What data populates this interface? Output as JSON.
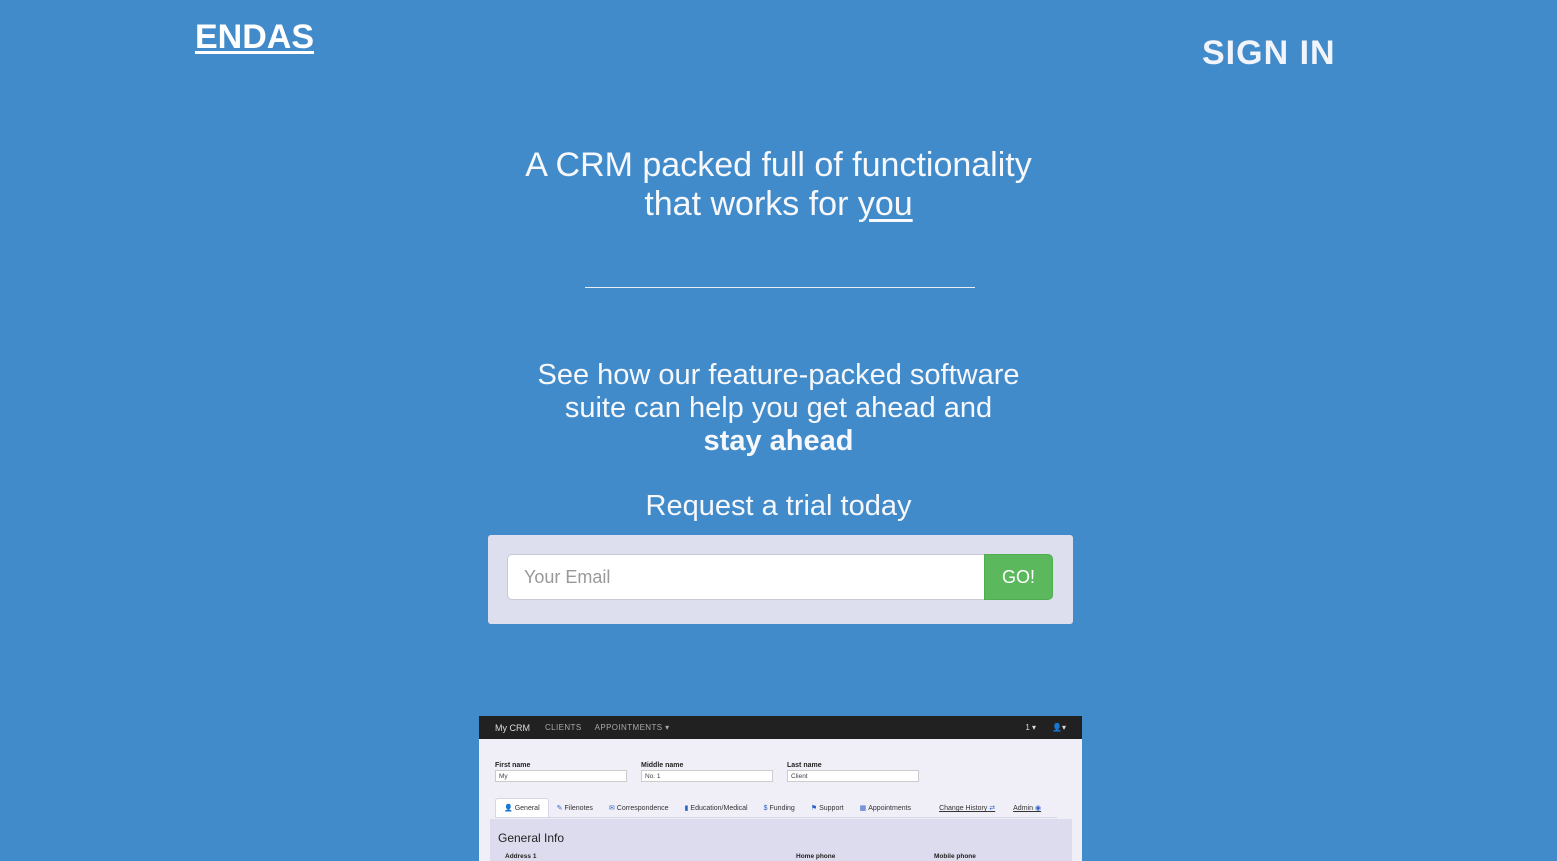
{
  "header": {
    "brand": "ENDAS",
    "sign_in": "SIGN IN"
  },
  "hero": {
    "headline_line1": "A CRM packed full of functionality",
    "headline_line2_pre": "that works for ",
    "headline_line2_underlined": "you",
    "sub_line1": "See how our feature-packed software",
    "sub_line2": "suite can help you get ahead and",
    "sub_bold": "stay ahead",
    "trial_text": "Request a trial today"
  },
  "signup": {
    "email_placeholder": "Your Email",
    "email_value": "",
    "go_label": "GO!"
  },
  "preview": {
    "nav": {
      "brand": "My CRM",
      "links": [
        "CLIENTS",
        "APPOINTMENTS ▾"
      ],
      "notifications": "1 ▾",
      "user": "▾"
    },
    "fields": [
      {
        "label": "First name",
        "value": "My"
      },
      {
        "label": "Middle name",
        "value": "No. 1"
      },
      {
        "label": "Last name",
        "value": "Client"
      }
    ],
    "tabs": [
      {
        "label": "General",
        "icon": "person-icon",
        "glyph": "👤"
      },
      {
        "label": "Filenotes",
        "icon": "pencil-icon",
        "glyph": "✎"
      },
      {
        "label": "Correspondence",
        "icon": "envelope-icon",
        "glyph": "✉"
      },
      {
        "label": "Education/Medical",
        "icon": "book-icon",
        "glyph": "▮"
      },
      {
        "label": "Funding",
        "icon": "dollar-icon",
        "glyph": "$"
      },
      {
        "label": "Support",
        "icon": "flag-icon",
        "glyph": "⚑"
      },
      {
        "label": "Appointments",
        "icon": "calendar-icon",
        "glyph": "▦"
      }
    ],
    "right_links": [
      {
        "label": "Change History",
        "icon": "shuffle-icon",
        "glyph": "⇄"
      },
      {
        "label": "Admin",
        "icon": "eye-off-icon",
        "glyph": "◉"
      }
    ],
    "panel_title": "General Info",
    "panel_labels": [
      "Address 1",
      "Home phone",
      "Mobile phone"
    ]
  },
  "colors": {
    "background": "#428bca",
    "go_button": "#5cb85c",
    "signup_box": "#dedfee"
  }
}
